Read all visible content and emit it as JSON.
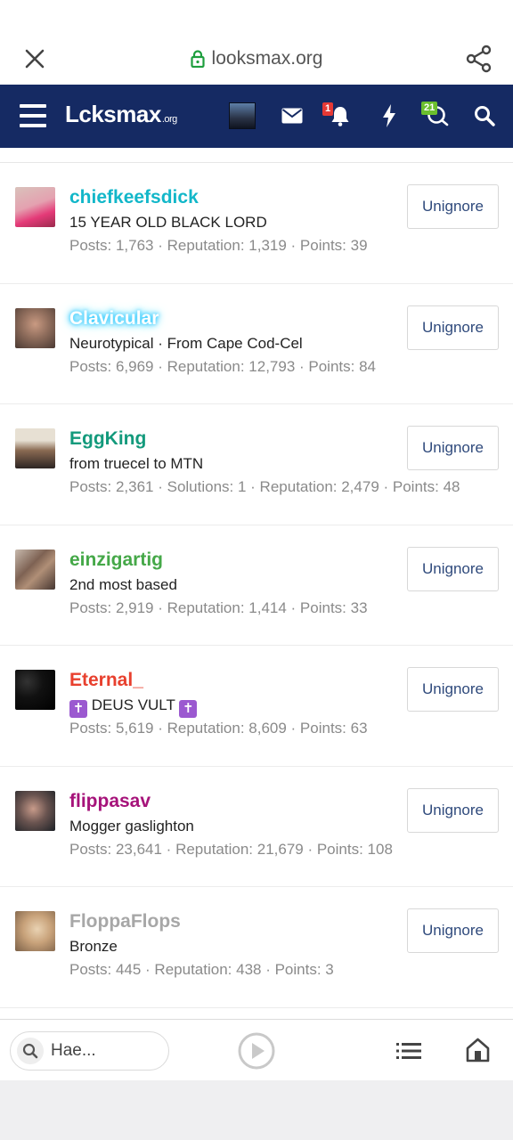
{
  "browser": {
    "url": "looksmax.org"
  },
  "header": {
    "logo_main": "Lcksmax",
    "logo_tld": ".org",
    "notifications_badge": "1",
    "conversations_badge": "21"
  },
  "colors": {
    "header_bg": "#152a63",
    "notif_badge": "#e53935",
    "conv_badge": "#6bbf2e"
  },
  "users": [
    {
      "name": "chiefkeefsdick",
      "name_color": "#12b7c9",
      "title": "15 YEAR OLD BLACK LORD",
      "stats": "Posts: 1,763 · Reputation: 1,319 · Points: 39",
      "button": "Unignore"
    },
    {
      "name": "Clavicular",
      "name_color": "#ffffff",
      "title": "Neurotypical · From Cape Cod-Cel",
      "stats": "Posts: 6,969 · Reputation: 12,793 · Points: 84",
      "button": "Unignore"
    },
    {
      "name": "EggKing",
      "name_color": "#139a7c",
      "title": "from truecel to MTN",
      "stats": "Posts: 2,361 · Solutions: 1 · Reputation: 2,479 · Points: 48",
      "button": "Unignore"
    },
    {
      "name": "einzigartig",
      "name_color": "#45a848",
      "title": "2nd most based",
      "stats": "Posts: 2,919 · Reputation: 1,414 · Points: 33",
      "button": "Unignore"
    },
    {
      "name": "Eternal_",
      "name_color": "#e8402e",
      "title_prefix": "✝",
      "title": "DEUS VULT",
      "title_suffix": "✝",
      "stats": "Posts: 5,619 · Reputation: 8,609 · Points: 63",
      "button": "Unignore"
    },
    {
      "name": "flippasav",
      "name_color": "#a6137a",
      "title": "Mogger gaslighton",
      "stats": "Posts: 23,641 · Reputation: 21,679 · Points: 108",
      "button": "Unignore"
    },
    {
      "name": "FloppaFlops",
      "name_color": "#a7a7a7",
      "title": "Bronze",
      "stats": "Posts: 445 · Reputation: 438 · Points: 3",
      "button": "Unignore"
    }
  ],
  "bottom": {
    "search_value": "Hae..."
  }
}
